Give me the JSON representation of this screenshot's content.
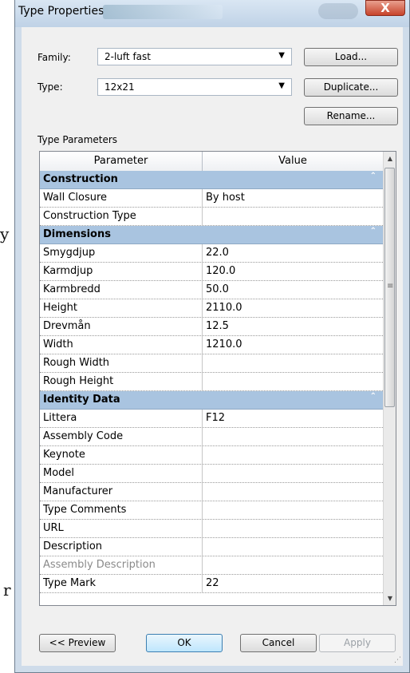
{
  "background": {
    "chars": [
      "y",
      "r"
    ]
  },
  "window": {
    "title": "Type Properties",
    "close_glyph": "X"
  },
  "form": {
    "family_label": "Family:",
    "family_value": "2-luft fast",
    "type_label": "Type:",
    "type_value": "12x21",
    "load_button": "Load...",
    "duplicate_button": "Duplicate...",
    "rename_button": "Rename...",
    "type_parameters_label": "Type Parameters"
  },
  "grid": {
    "columns": [
      "Parameter",
      "Value"
    ],
    "groups": [
      {
        "name": "Construction",
        "rows": [
          {
            "parameter": "Wall Closure",
            "value": "By host"
          },
          {
            "parameter": "Construction Type",
            "value": ""
          }
        ]
      },
      {
        "name": "Dimensions",
        "rows": [
          {
            "parameter": "Smygdjup",
            "value": "22.0"
          },
          {
            "parameter": "Karmdjup",
            "value": "120.0"
          },
          {
            "parameter": "Karmbredd",
            "value": "50.0"
          },
          {
            "parameter": "Height",
            "value": "2110.0"
          },
          {
            "parameter": "Drevmån",
            "value": "12.5"
          },
          {
            "parameter": "Width",
            "value": "1210.0"
          },
          {
            "parameter": "Rough Width",
            "value": ""
          },
          {
            "parameter": "Rough Height",
            "value": ""
          }
        ]
      },
      {
        "name": "Identity Data",
        "rows": [
          {
            "parameter": "Littera",
            "value": "F12"
          },
          {
            "parameter": "Assembly Code",
            "value": ""
          },
          {
            "parameter": "Keynote",
            "value": ""
          },
          {
            "parameter": "Model",
            "value": ""
          },
          {
            "parameter": "Manufacturer",
            "value": ""
          },
          {
            "parameter": "Type Comments",
            "value": ""
          },
          {
            "parameter": "URL",
            "value": ""
          },
          {
            "parameter": "Description",
            "value": ""
          },
          {
            "parameter": "Assembly Description",
            "value": "",
            "disabled": true
          },
          {
            "parameter": "Type Mark",
            "value": "22"
          }
        ]
      }
    ]
  },
  "footer": {
    "preview_button": "<< Preview",
    "ok_button": "OK",
    "cancel_button": "Cancel",
    "apply_button": "Apply"
  },
  "icons": {
    "collapse": "chevron-double-up-icon",
    "dropdown": "triangle-down-icon",
    "scroll_up": "arrow-up-icon",
    "scroll_down": "arrow-down-icon"
  }
}
